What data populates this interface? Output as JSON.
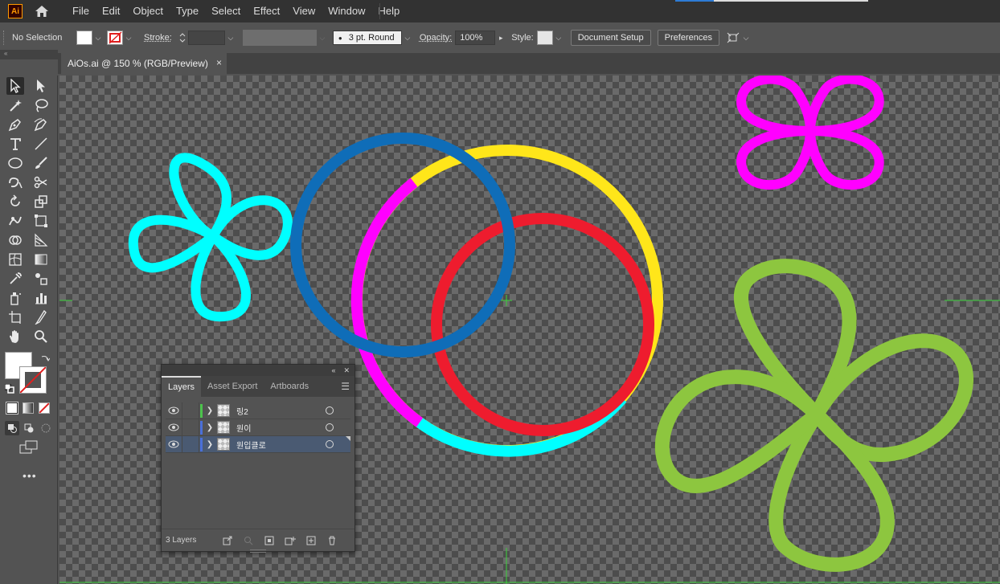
{
  "app": {
    "logo": "Ai"
  },
  "menu": [
    "File",
    "Edit",
    "Object",
    "Type",
    "Select",
    "Effect",
    "View",
    "Window",
    "Help"
  ],
  "control_bar": {
    "selection_label": "No Selection",
    "stroke_label": "Stroke:",
    "brush_label": "3 pt. Round",
    "opacity_label": "Opacity:",
    "opacity_value": "100%",
    "style_label": "Style:",
    "document_setup": "Document Setup",
    "preferences": "Preferences"
  },
  "document_tab": {
    "title": "AiOs.ai @ 150 % (RGB/Preview)",
    "close": "×"
  },
  "layers_panel": {
    "tabs": [
      "Layers",
      "Asset Export",
      "Artboards"
    ],
    "layers": [
      {
        "name": "링2",
        "color": "#4cc34c"
      },
      {
        "name": "원이",
        "color": "#4a6fd8"
      },
      {
        "name": "원입클로",
        "color": "#4a6fd8"
      }
    ],
    "count": "3 Layers"
  },
  "colors": {
    "blue_ring": "#0f6db8",
    "yellow_ring": "#ffe61a",
    "magenta": "#ff00ff",
    "red_ring": "#ee1c2e",
    "cyan": "#00ffff",
    "green_clover": "#8dc63f"
  },
  "icons": {
    "toolbar": [
      "selection",
      "direct-selection",
      "magic-wand",
      "lasso",
      "pen",
      "curvature",
      "type",
      "line",
      "ellipse",
      "paintbrush",
      "shaper",
      "scissors",
      "rotate",
      "scale",
      "warp",
      "free-transform",
      "shape-builder",
      "perspective",
      "mesh",
      "gradient",
      "eyedropper",
      "blend",
      "symbol-sprayer",
      "column-graph",
      "artboard",
      "slice",
      "hand",
      "zoom"
    ]
  }
}
